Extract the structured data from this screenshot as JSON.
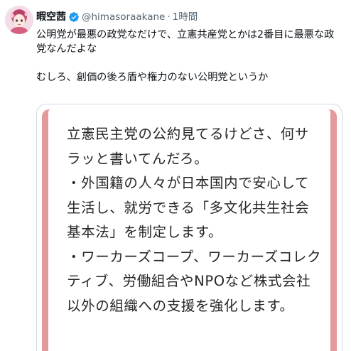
{
  "tweet": {
    "author": {
      "display_name": "暇空茜",
      "handle": "@himasoraakane",
      "separator": "·",
      "time": "1時間",
      "verified_icon": "verified-badge-icon"
    },
    "text": {
      "paragraph_1": "公明党が最悪の政党なだけで、立憲共産党とかは2番目に最悪な政党なんだよな",
      "paragraph_2": "むしろ、創価の後ろ盾や権力のない公明党というか"
    },
    "image": {
      "lines": [
        "立憲民主党の公約見てるけどさ、何サラッと書いてんだろ。",
        "・外国籍の人々が日本国内で安心して生活し、就労できる「多文化共生社会基本法」を制定します。",
        "・ワーカーズコープ、ワーカーズコレクティブ、労働組合やNPOなど株式会社以外の組織への支援を強化します。"
      ]
    }
  },
  "colors": {
    "text_primary": "#0f1419",
    "text_secondary": "#536471",
    "verified_blue": "#1d9bf0",
    "image_frame": "#e29a9a"
  }
}
